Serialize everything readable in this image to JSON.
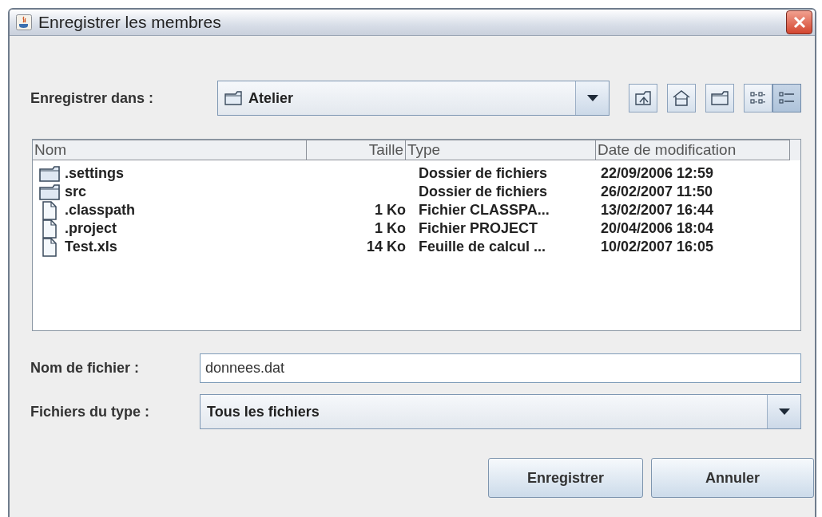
{
  "window": {
    "title": "Enregistrer les membres"
  },
  "save_in": {
    "label": "Enregistrer dans :",
    "value": "Atelier"
  },
  "toolbar": [
    {
      "kind": "up",
      "selected": false
    },
    {
      "kind": "home",
      "selected": false
    },
    {
      "kind": "new-folder",
      "selected": false
    },
    {
      "kind": "list-view",
      "selected": false
    },
    {
      "kind": "details-view",
      "selected": true
    }
  ],
  "file_list": {
    "columns": [
      "Nom",
      "Taille",
      "Type",
      "Date de modification"
    ],
    "rows": [
      {
        "kind": "folder",
        "name": ".settings",
        "type": "Dossier de fichiers",
        "date": "22/09/2006 12:59"
      },
      {
        "kind": "folder",
        "name": "src",
        "type": "Dossier de fichiers",
        "date": "26/02/2007 11:50"
      },
      {
        "kind": "file",
        "name": ".classpath",
        "size": "1 Ko",
        "type": "Fichier CLASSPA...",
        "date": "13/02/2007 16:44"
      },
      {
        "kind": "file",
        "name": ".project",
        "size": "1 Ko",
        "type": "Fichier PROJECT",
        "date": "20/04/2006 18:04"
      },
      {
        "kind": "file",
        "name": "Test.xls",
        "size": "14 Ko",
        "type": "Feuille de calcul ...",
        "date": "10/02/2007 16:05"
      }
    ]
  },
  "file_name": {
    "label": "Nom de fichier :",
    "value": "donnees.dat"
  },
  "file_type": {
    "label": "Fichiers du type :",
    "value": "Tous les fichiers"
  },
  "buttons": [
    "Enregistrer",
    "Annuler"
  ]
}
